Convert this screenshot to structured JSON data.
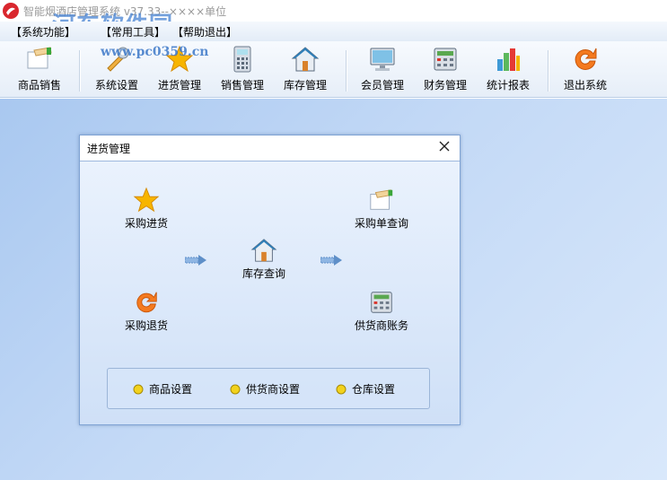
{
  "window": {
    "title": "智能烟酒店管理系统 v37.33--××××单位",
    "watermark": "河东软件园",
    "watermark_url": "www.pc0359.cn"
  },
  "menu": [
    "【系统功能】",
    "【常用工具】",
    "【帮助退出】"
  ],
  "toolbar": {
    "items": [
      {
        "label": "商品销售",
        "icon": "sales-hand-icon"
      },
      {
        "label": "系统设置",
        "icon": "wrench-icon"
      },
      {
        "label": "进货管理",
        "icon": "star-icon"
      },
      {
        "label": "销售管理",
        "icon": "calculator-icon"
      },
      {
        "label": "库存管理",
        "icon": "house-icon"
      },
      {
        "label": "会员管理",
        "icon": "monitor-icon"
      },
      {
        "label": "财务管理",
        "icon": "cash-register-icon"
      },
      {
        "label": "统计报表",
        "icon": "bar-chart-icon"
      },
      {
        "label": "退出系统",
        "icon": "refresh-icon"
      }
    ]
  },
  "dialog": {
    "title": "进货管理",
    "functions": {
      "purchase_in": "采购进货",
      "purchase_query": "采购单查询",
      "stock_query": "库存查询",
      "purchase_return": "采购退货",
      "supplier_account": "供货商账务"
    },
    "settings": [
      "商品设置",
      "供货商设置",
      "仓库设置"
    ]
  },
  "colors": {
    "workspace": "#bcd4f4",
    "dialog_border": "#7fa3d4",
    "accent_orange": "#f47a1f",
    "star_yellow": "#f7b500"
  }
}
